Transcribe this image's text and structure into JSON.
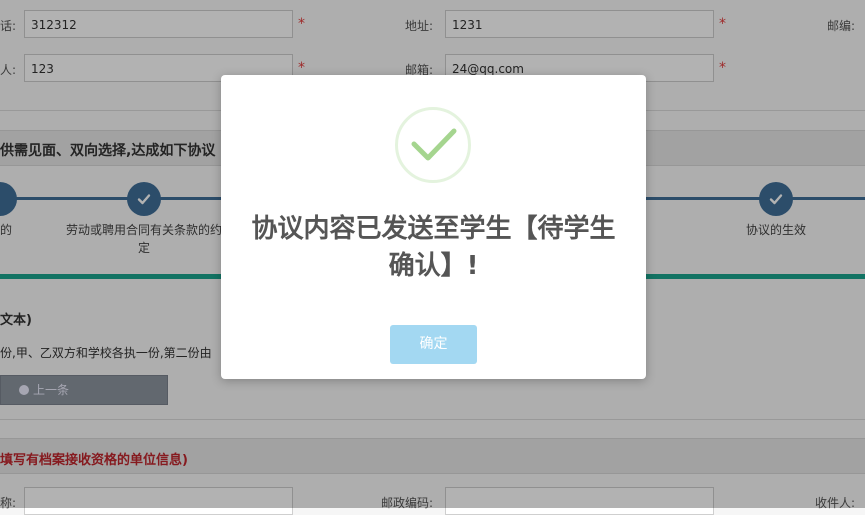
{
  "form": {
    "phone_label": "话:",
    "phone_value": "312312",
    "address_label": "地址:",
    "address_value": "1231",
    "postcode_label": "邮编:",
    "contact_label": "人:",
    "contact_value": "123",
    "email_label": "邮箱:",
    "email_value": "24@qq.com",
    "required_mark": "*"
  },
  "agreement_banner": "供需见面、双向选择,达成如下协议",
  "steps": [
    {
      "label": "的"
    },
    {
      "label": "劳动或聘用合同有关条款的约定"
    },
    {
      "label": "协议的生效"
    }
  ],
  "text_section": {
    "heading": "文本)",
    "copies_note": "份,甲、乙双方和学校各执一份,第二份由",
    "prev_button": "上一条"
  },
  "archive_banner": "填写有档案接收资格的单位信息)",
  "bottom_form": {
    "name_label": "称:",
    "postal_code_label": "邮政编码:",
    "recipient_label": "收件人:"
  },
  "modal": {
    "message": "协议内容已发送至学生【待学生确认】!",
    "ok_label": "确定",
    "success_color": "#a5d58f"
  }
}
